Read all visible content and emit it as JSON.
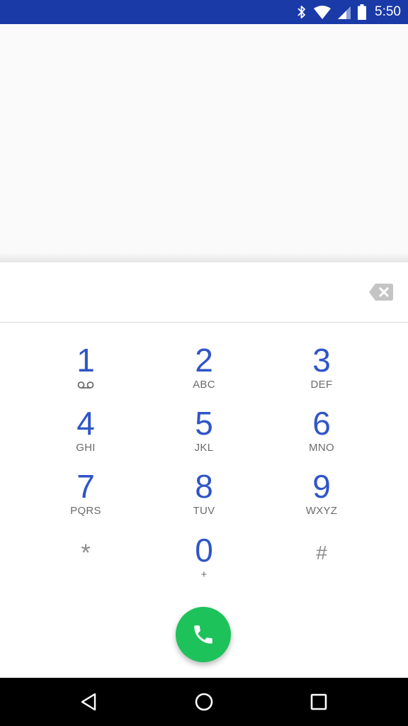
{
  "status_bar": {
    "time": "5:50",
    "icons": [
      "bluetooth-icon",
      "wifi-icon",
      "cell-signal-icon",
      "battery-icon"
    ],
    "background": "#1a3aa8"
  },
  "dialpad": {
    "digits_value": "",
    "keys": [
      {
        "digit": "1",
        "letters": "",
        "sub_icon": "voicemail-icon"
      },
      {
        "digit": "2",
        "letters": "ABC"
      },
      {
        "digit": "3",
        "letters": "DEF"
      },
      {
        "digit": "4",
        "letters": "GHI"
      },
      {
        "digit": "5",
        "letters": "JKL"
      },
      {
        "digit": "6",
        "letters": "MNO"
      },
      {
        "digit": "7",
        "letters": "PQRS"
      },
      {
        "digit": "8",
        "letters": "TUV"
      },
      {
        "digit": "9",
        "letters": "WXYZ"
      },
      {
        "digit": "*",
        "letters": ""
      },
      {
        "digit": "0",
        "letters": "+"
      },
      {
        "digit": "#",
        "letters": ""
      }
    ],
    "digit_color": "#2f55c8",
    "call_button_color": "#1ec25a"
  },
  "nav_bar": {
    "icons": [
      "back-icon",
      "home-icon",
      "recents-icon"
    ]
  }
}
